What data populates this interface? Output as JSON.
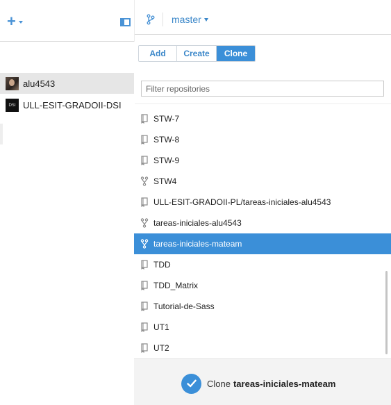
{
  "toolbar": {
    "add_icon": "plus-icon",
    "sidebar_toggle_icon": "sidebar-toggle-icon",
    "branch_icon": "branch-icon",
    "branch_name": "master"
  },
  "tabs": [
    {
      "label": "Add",
      "active": false
    },
    {
      "label": "Create",
      "active": false
    },
    {
      "label": "Clone",
      "active": true
    }
  ],
  "sidebar": {
    "accounts": [
      {
        "label": "alu4543",
        "selected": true,
        "avatar": "user-avatar"
      },
      {
        "label": "ULL-ESIT-GRADOII-DSI",
        "selected": false,
        "avatar": "org-avatar",
        "avatar_text": "DSI"
      }
    ]
  },
  "filter": {
    "placeholder": "Filter repositories",
    "value": ""
  },
  "repositories": [
    {
      "name": "STW-7",
      "icon": "repo"
    },
    {
      "name": "STW-8",
      "icon": "repo"
    },
    {
      "name": "STW-9",
      "icon": "repo"
    },
    {
      "name": "STW4",
      "icon": "fork"
    },
    {
      "name": "ULL-ESIT-GRADOII-PL/tareas-iniciales-alu4543",
      "icon": "repo"
    },
    {
      "name": "tareas-iniciales-alu4543",
      "icon": "fork"
    },
    {
      "name": "tareas-iniciales-mateam",
      "icon": "fork",
      "selected": true
    },
    {
      "name": "TDD",
      "icon": "repo"
    },
    {
      "name": "TDD_Matrix",
      "icon": "repo"
    },
    {
      "name": "Tutorial-de-Sass",
      "icon": "repo"
    },
    {
      "name": "UT1",
      "icon": "repo"
    },
    {
      "name": "UT2",
      "icon": "repo"
    }
  ],
  "footer": {
    "action_verb": "Clone",
    "action_target": "tareas-iniciales-mateam",
    "icon": "check-icon"
  },
  "colors": {
    "accent": "#3b8fd8",
    "selected_sidebar": "#e6e6e6",
    "footer_bg": "#f3f3f3"
  }
}
